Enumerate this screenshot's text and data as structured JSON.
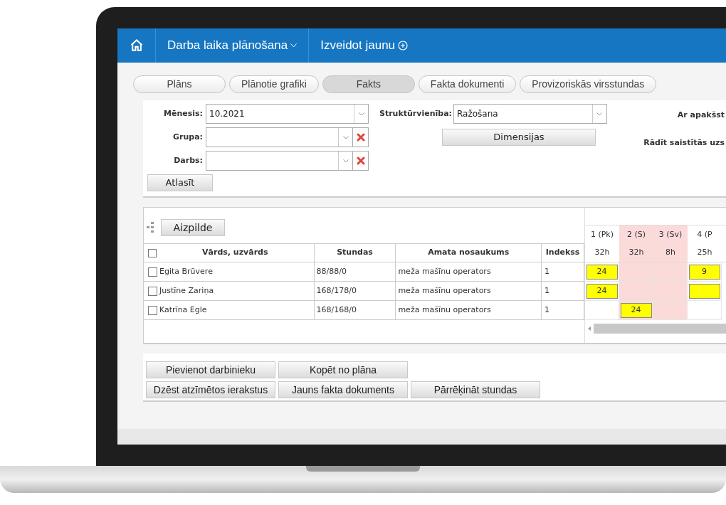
{
  "header": {
    "module": "Darba laika plānošana",
    "create": "Izveidot jaunu"
  },
  "tabs": [
    {
      "label": "Plāns",
      "selected": false
    },
    {
      "label": "Plānotie grafiki",
      "selected": false
    },
    {
      "label": "Fakts",
      "selected": true
    },
    {
      "label": "Fakta dokumenti",
      "selected": false
    },
    {
      "label": "Provizoriskās virsstundas",
      "selected": false
    }
  ],
  "filters": {
    "month": {
      "label": "Mēnesis:",
      "value": "10.2021"
    },
    "group": {
      "label": "Grupa:"
    },
    "job": {
      "label": "Darbs:"
    },
    "unit": {
      "label": "Struktūrvienība:",
      "value": "Ražošana"
    },
    "dimensions_button": "Dimensijas",
    "right_labels": [
      "Ar apakšst",
      "Rādīt saistītās uzs"
    ],
    "select_button": "Atlasīt"
  },
  "table": {
    "fill_button": "Aizpilde",
    "all_checked": false,
    "columns": [
      "Vārds, uzvārds",
      "Stundas",
      "Amata nosaukums",
      "Indekss"
    ],
    "days": [
      {
        "label": "1 (Pk)",
        "hours": "32h",
        "weekend": false
      },
      {
        "label": "2 (S)",
        "hours": "32h",
        "weekend": true
      },
      {
        "label": "3 (Sv)",
        "hours": "8h",
        "weekend": true
      },
      {
        "label": "4 (P",
        "hours": "25h",
        "weekend": false
      }
    ],
    "rows": [
      {
        "checked": false,
        "name": "Egita Brūvere",
        "hours": "88/88/0",
        "position": "meža mašīnu operators",
        "index": "1",
        "cells": [
          {
            "bar": true,
            "text": "24"
          },
          {
            "bar": false
          },
          {
            "bar": false
          },
          {
            "bar": true,
            "text": "9"
          }
        ]
      },
      {
        "checked": false,
        "name": "Justīne Zariņa",
        "hours": "168/178/0",
        "position": "meža mašīnu operators",
        "index": "1",
        "cells": [
          {
            "bar": true,
            "text": "24"
          },
          {
            "bar": false
          },
          {
            "bar": false
          },
          {
            "bar": true
          }
        ]
      },
      {
        "checked": false,
        "name": "Katrīna Egle",
        "hours": "168/168/0",
        "position": "meža mašīnu operators",
        "index": "1",
        "cells": [
          {
            "bar": false
          },
          {
            "bar": true,
            "text": "24"
          },
          {
            "bar": false
          },
          {
            "bar": false
          }
        ]
      }
    ]
  },
  "actions": [
    [
      "Pievienot darbinieku",
      "Kopēt no plāna"
    ],
    [
      "Dzēst atzīmētos ierakstus",
      "Jauns fakta dokuments",
      "Pārrēķināt stundas"
    ]
  ]
}
